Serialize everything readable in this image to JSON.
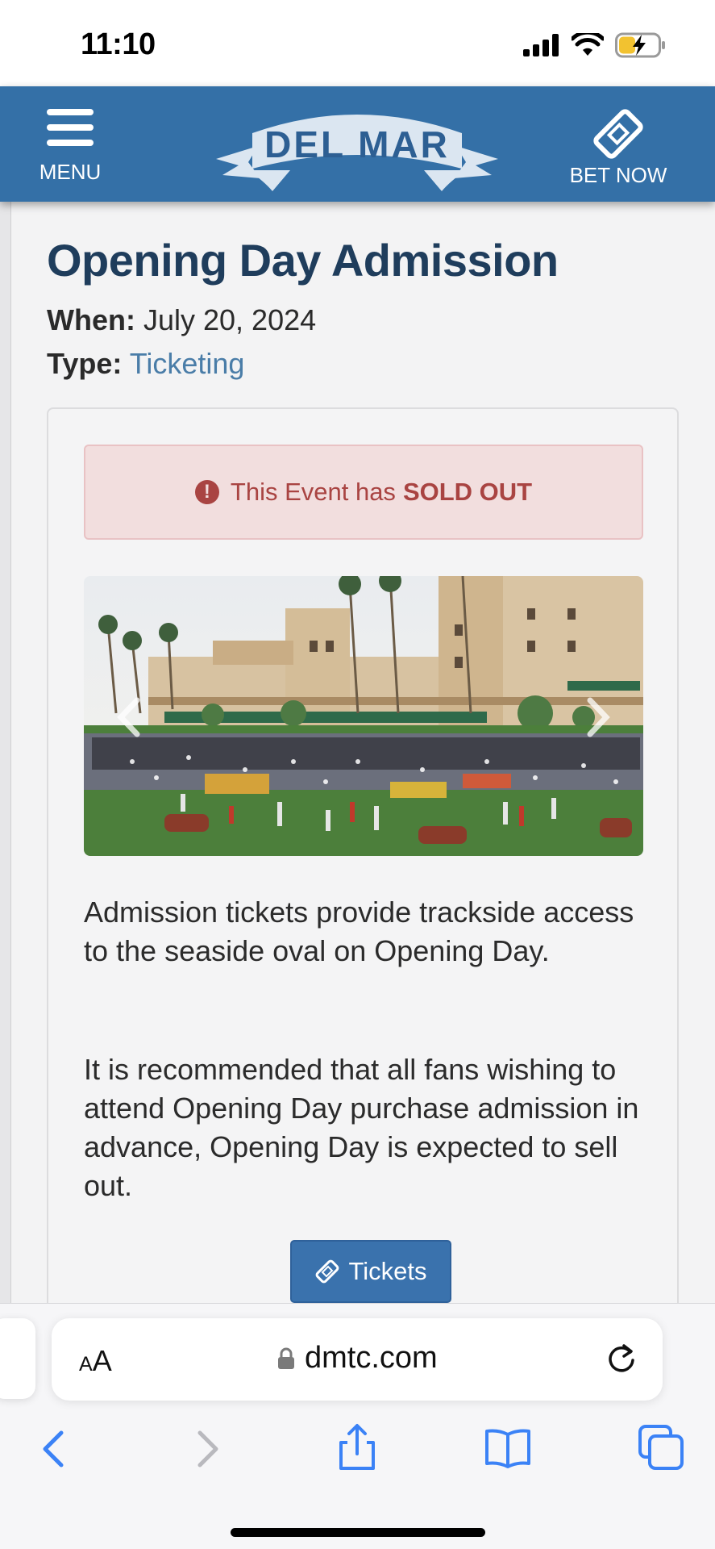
{
  "status_bar": {
    "time": "11:10"
  },
  "header": {
    "menu_label": "MENU",
    "logo_text": "DEL MAR",
    "bet_now_label": "BET NOW",
    "brand_color": "#3470a7"
  },
  "event": {
    "title": "Opening Day Admission",
    "when_label": "When:",
    "when_value": "July 20, 2024",
    "type_label": "Type:",
    "type_value": "Ticketing"
  },
  "alert": {
    "icon": "exclamation-circle-icon",
    "text": "This Event has",
    "bold_text": "SOLD OUT",
    "color": "#a94442"
  },
  "description": {
    "paragraph_1": "Admission tickets provide trackside access to the seaside oval on Opening Day.",
    "paragraph_2": "It is recommended that all fans wishing to attend Opening Day purchase admission in advance, Opening Day is expected to sell out."
  },
  "tickets_button": {
    "label": "Tickets",
    "icon": "ticket-icon"
  },
  "browser": {
    "text_size_label_small": "A",
    "text_size_label_large": "A",
    "url": "dmtc.com"
  }
}
